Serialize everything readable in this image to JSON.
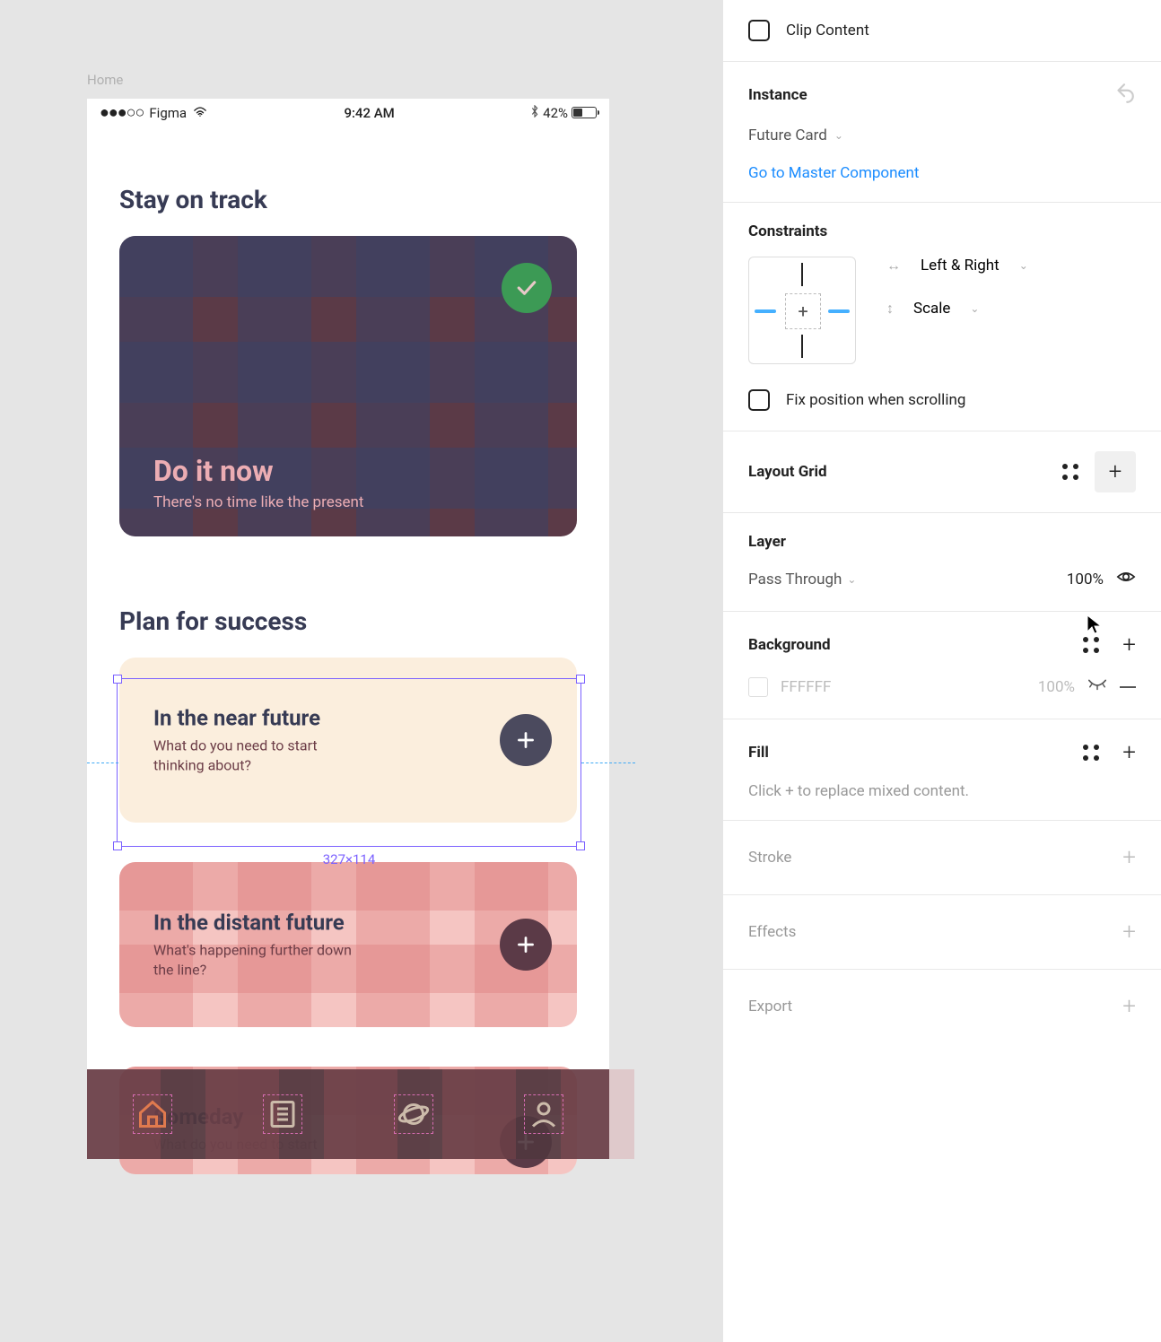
{
  "canvas": {
    "frame_label": "Home",
    "status_bar": {
      "signal": "●●●○○",
      "carrier": "Figma",
      "time": "9:42 AM",
      "battery_pct": "42%"
    },
    "section1_title": "Stay on track",
    "card1": {
      "title": "Do it now",
      "subtitle": "There's no time like the present"
    },
    "section2_title": "Plan for success",
    "card_near": {
      "title": "In the near future",
      "subtitle": "What do you need to start thinking about?"
    },
    "card_distant": {
      "title": "In the distant future",
      "subtitle": "What's happening further down the line?"
    },
    "card_someday": {
      "title": "Someday",
      "subtitle": "What do you need to start"
    },
    "selection_dims": "327×114"
  },
  "panel": {
    "clip_content": "Clip Content",
    "instance": {
      "heading": "Instance",
      "name": "Future Card",
      "master_link": "Go to Master Component"
    },
    "constraints": {
      "heading": "Constraints",
      "horizontal": "Left & Right",
      "vertical": "Scale",
      "fix_position": "Fix position when scrolling"
    },
    "layout_grid": {
      "heading": "Layout Grid"
    },
    "layer": {
      "heading": "Layer",
      "blend": "Pass Through",
      "opacity": "100%"
    },
    "background": {
      "heading": "Background",
      "hex": "FFFFFF",
      "opacity": "100%"
    },
    "fill": {
      "heading": "Fill",
      "hint": "Click + to replace mixed content."
    },
    "stroke": {
      "heading": "Stroke"
    },
    "effects": {
      "heading": "Effects"
    },
    "export": {
      "heading": "Export"
    }
  }
}
